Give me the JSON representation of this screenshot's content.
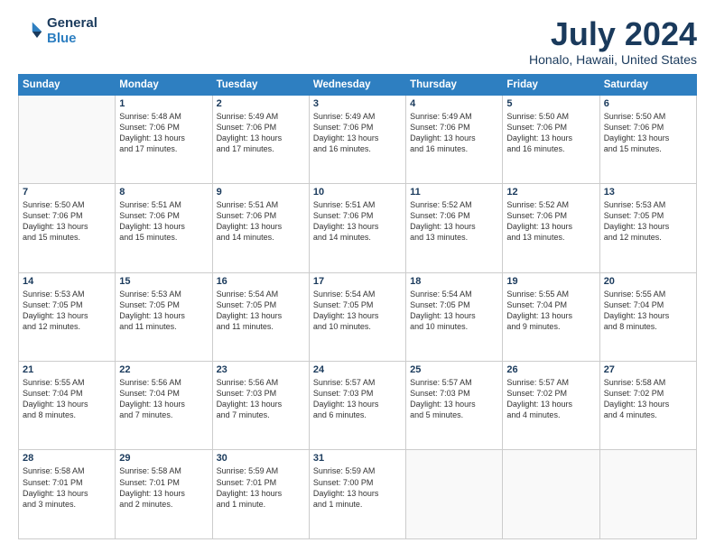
{
  "logo": {
    "line1": "General",
    "line2": "Blue"
  },
  "title": "July 2024",
  "subtitle": "Honalo, Hawaii, United States",
  "weekdays": [
    "Sunday",
    "Monday",
    "Tuesday",
    "Wednesday",
    "Thursday",
    "Friday",
    "Saturday"
  ],
  "weeks": [
    [
      {
        "day": "",
        "info": ""
      },
      {
        "day": "1",
        "info": "Sunrise: 5:48 AM\nSunset: 7:06 PM\nDaylight: 13 hours\nand 17 minutes."
      },
      {
        "day": "2",
        "info": "Sunrise: 5:49 AM\nSunset: 7:06 PM\nDaylight: 13 hours\nand 17 minutes."
      },
      {
        "day": "3",
        "info": "Sunrise: 5:49 AM\nSunset: 7:06 PM\nDaylight: 13 hours\nand 16 minutes."
      },
      {
        "day": "4",
        "info": "Sunrise: 5:49 AM\nSunset: 7:06 PM\nDaylight: 13 hours\nand 16 minutes."
      },
      {
        "day": "5",
        "info": "Sunrise: 5:50 AM\nSunset: 7:06 PM\nDaylight: 13 hours\nand 16 minutes."
      },
      {
        "day": "6",
        "info": "Sunrise: 5:50 AM\nSunset: 7:06 PM\nDaylight: 13 hours\nand 15 minutes."
      }
    ],
    [
      {
        "day": "7",
        "info": "Sunrise: 5:50 AM\nSunset: 7:06 PM\nDaylight: 13 hours\nand 15 minutes."
      },
      {
        "day": "8",
        "info": "Sunrise: 5:51 AM\nSunset: 7:06 PM\nDaylight: 13 hours\nand 15 minutes."
      },
      {
        "day": "9",
        "info": "Sunrise: 5:51 AM\nSunset: 7:06 PM\nDaylight: 13 hours\nand 14 minutes."
      },
      {
        "day": "10",
        "info": "Sunrise: 5:51 AM\nSunset: 7:06 PM\nDaylight: 13 hours\nand 14 minutes."
      },
      {
        "day": "11",
        "info": "Sunrise: 5:52 AM\nSunset: 7:06 PM\nDaylight: 13 hours\nand 13 minutes."
      },
      {
        "day": "12",
        "info": "Sunrise: 5:52 AM\nSunset: 7:06 PM\nDaylight: 13 hours\nand 13 minutes."
      },
      {
        "day": "13",
        "info": "Sunrise: 5:53 AM\nSunset: 7:05 PM\nDaylight: 13 hours\nand 12 minutes."
      }
    ],
    [
      {
        "day": "14",
        "info": "Sunrise: 5:53 AM\nSunset: 7:05 PM\nDaylight: 13 hours\nand 12 minutes."
      },
      {
        "day": "15",
        "info": "Sunrise: 5:53 AM\nSunset: 7:05 PM\nDaylight: 13 hours\nand 11 minutes."
      },
      {
        "day": "16",
        "info": "Sunrise: 5:54 AM\nSunset: 7:05 PM\nDaylight: 13 hours\nand 11 minutes."
      },
      {
        "day": "17",
        "info": "Sunrise: 5:54 AM\nSunset: 7:05 PM\nDaylight: 13 hours\nand 10 minutes."
      },
      {
        "day": "18",
        "info": "Sunrise: 5:54 AM\nSunset: 7:05 PM\nDaylight: 13 hours\nand 10 minutes."
      },
      {
        "day": "19",
        "info": "Sunrise: 5:55 AM\nSunset: 7:04 PM\nDaylight: 13 hours\nand 9 minutes."
      },
      {
        "day": "20",
        "info": "Sunrise: 5:55 AM\nSunset: 7:04 PM\nDaylight: 13 hours\nand 8 minutes."
      }
    ],
    [
      {
        "day": "21",
        "info": "Sunrise: 5:55 AM\nSunset: 7:04 PM\nDaylight: 13 hours\nand 8 minutes."
      },
      {
        "day": "22",
        "info": "Sunrise: 5:56 AM\nSunset: 7:04 PM\nDaylight: 13 hours\nand 7 minutes."
      },
      {
        "day": "23",
        "info": "Sunrise: 5:56 AM\nSunset: 7:03 PM\nDaylight: 13 hours\nand 7 minutes."
      },
      {
        "day": "24",
        "info": "Sunrise: 5:57 AM\nSunset: 7:03 PM\nDaylight: 13 hours\nand 6 minutes."
      },
      {
        "day": "25",
        "info": "Sunrise: 5:57 AM\nSunset: 7:03 PM\nDaylight: 13 hours\nand 5 minutes."
      },
      {
        "day": "26",
        "info": "Sunrise: 5:57 AM\nSunset: 7:02 PM\nDaylight: 13 hours\nand 4 minutes."
      },
      {
        "day": "27",
        "info": "Sunrise: 5:58 AM\nSunset: 7:02 PM\nDaylight: 13 hours\nand 4 minutes."
      }
    ],
    [
      {
        "day": "28",
        "info": "Sunrise: 5:58 AM\nSunset: 7:01 PM\nDaylight: 13 hours\nand 3 minutes."
      },
      {
        "day": "29",
        "info": "Sunrise: 5:58 AM\nSunset: 7:01 PM\nDaylight: 13 hours\nand 2 minutes."
      },
      {
        "day": "30",
        "info": "Sunrise: 5:59 AM\nSunset: 7:01 PM\nDaylight: 13 hours\nand 1 minute."
      },
      {
        "day": "31",
        "info": "Sunrise: 5:59 AM\nSunset: 7:00 PM\nDaylight: 13 hours\nand 1 minute."
      },
      {
        "day": "",
        "info": ""
      },
      {
        "day": "",
        "info": ""
      },
      {
        "day": "",
        "info": ""
      }
    ]
  ]
}
